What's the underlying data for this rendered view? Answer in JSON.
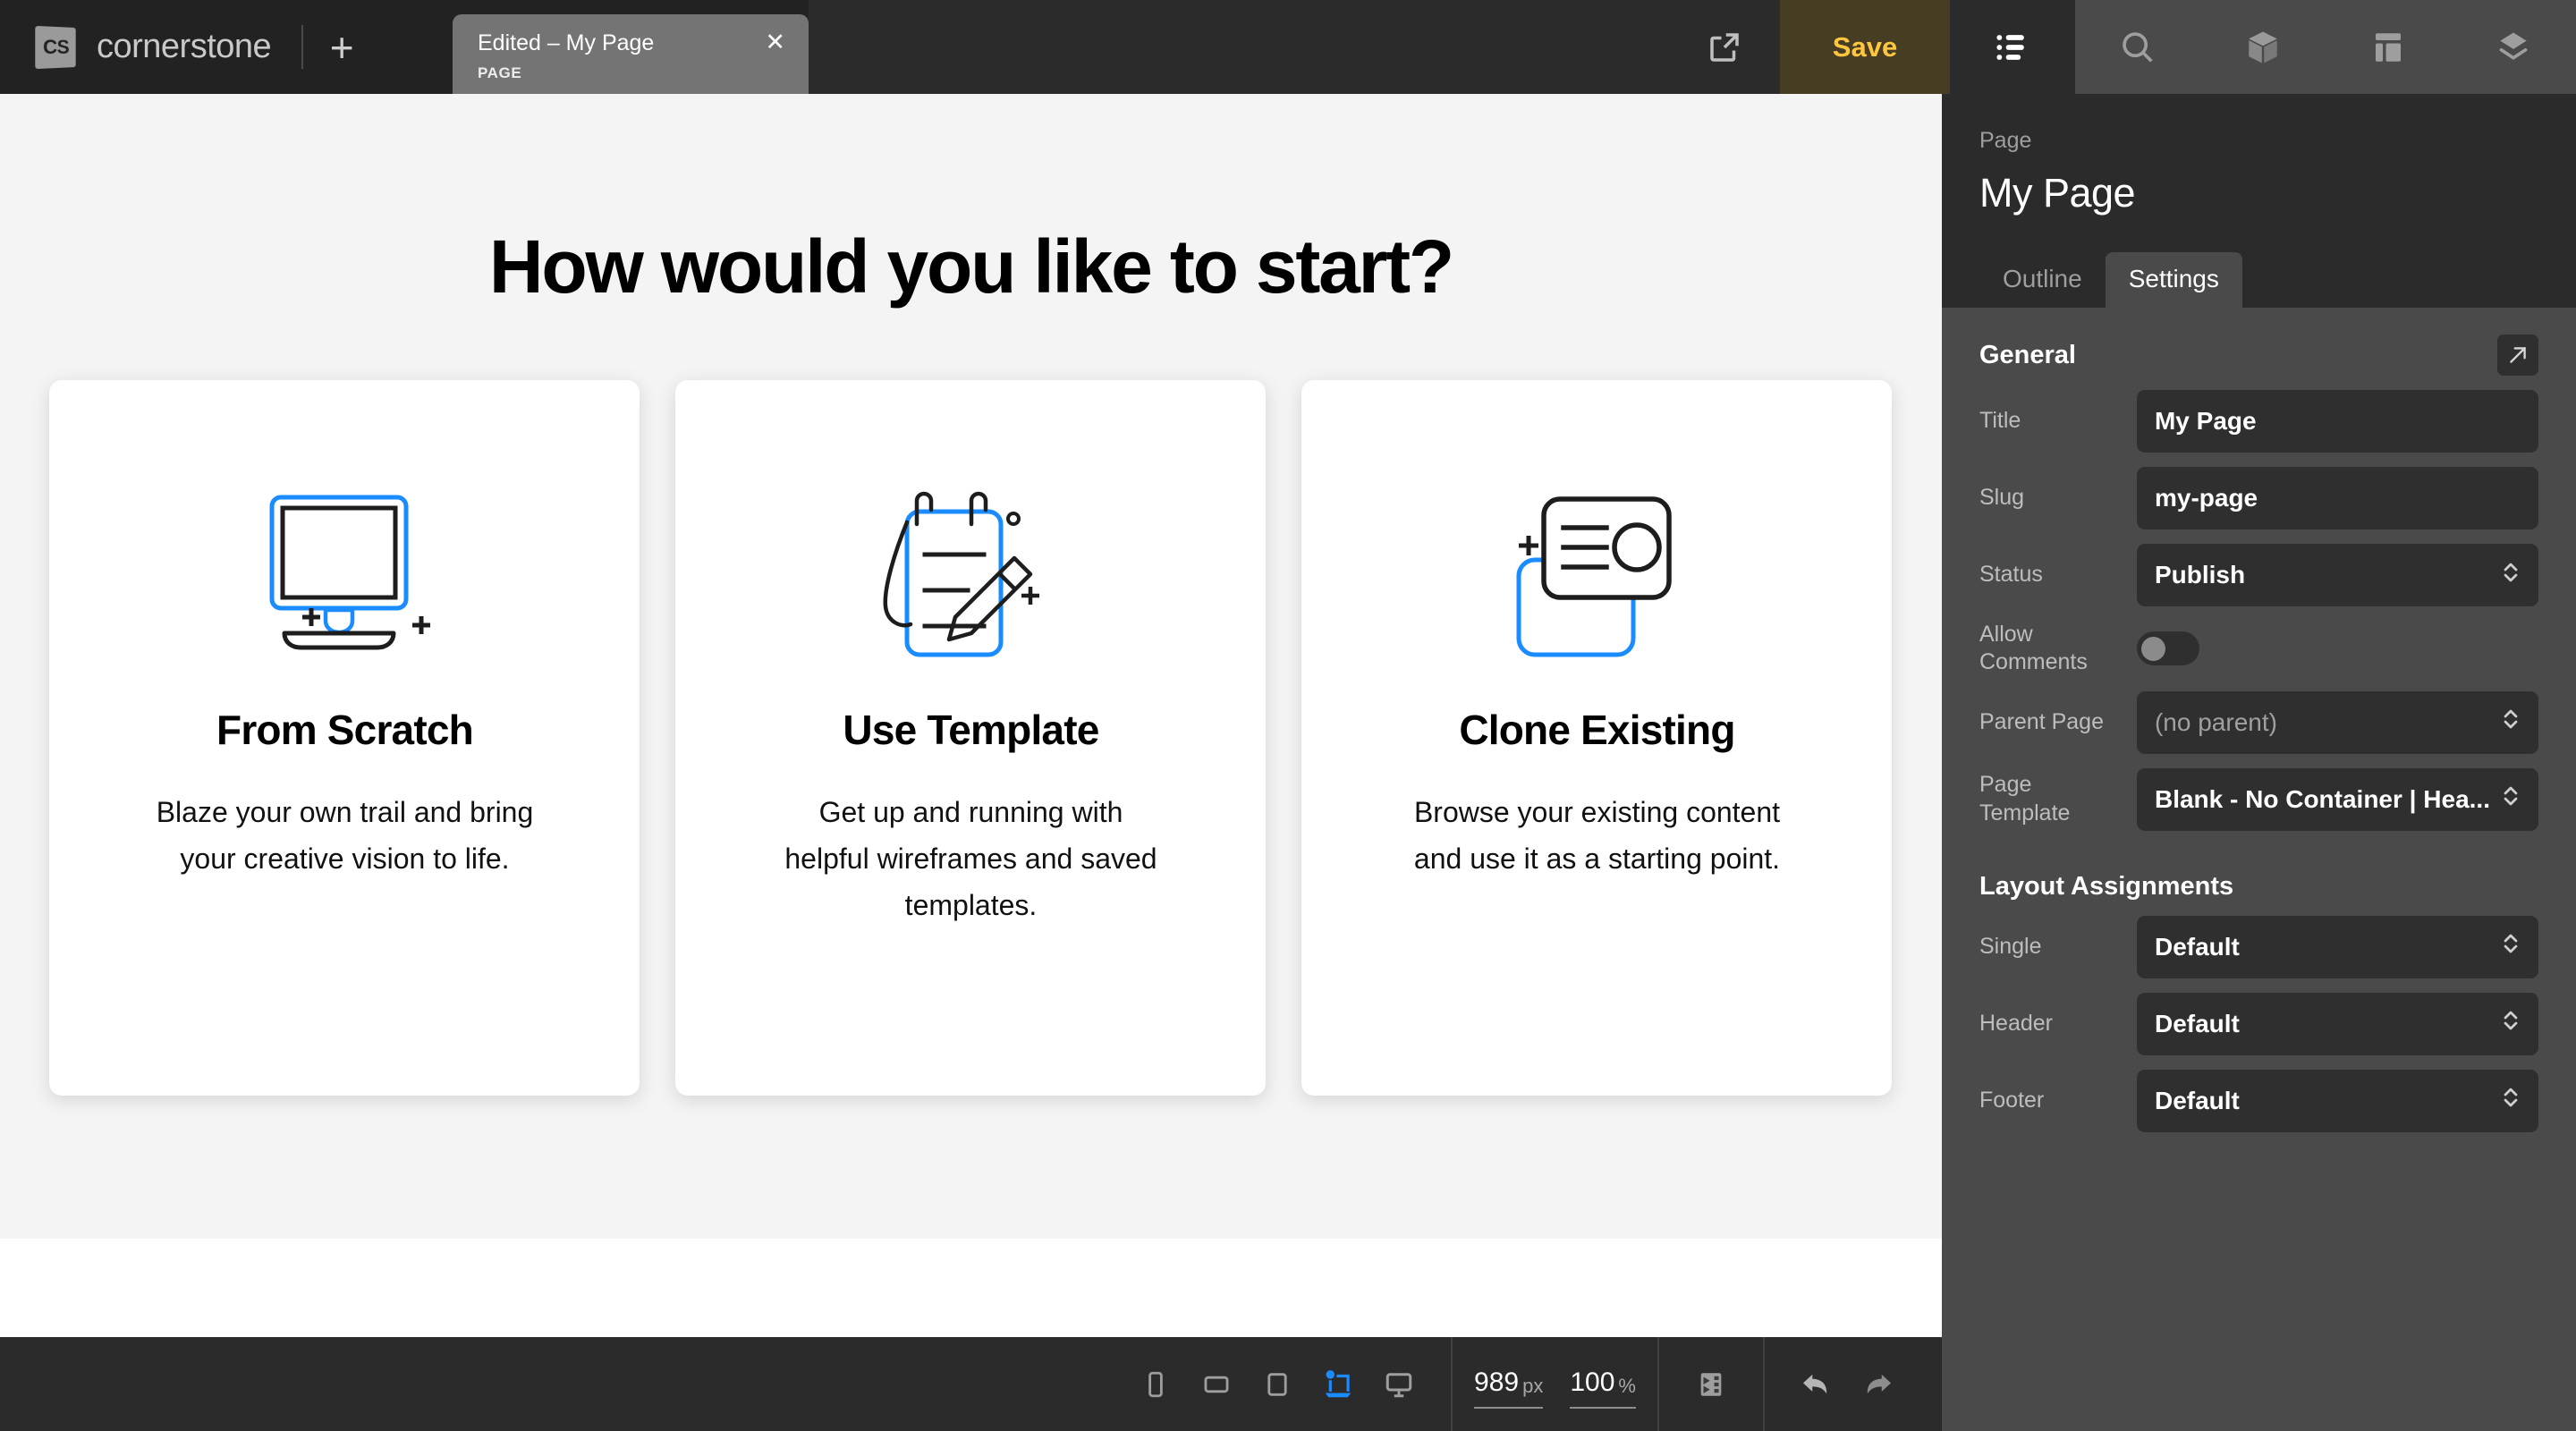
{
  "topbar": {
    "logo_text": "CS",
    "brand_name": "cornerstone",
    "new_tab_label": "+",
    "tab": {
      "title": "Edited – My Page",
      "subtitle": "PAGE",
      "close_label": "✕"
    },
    "export_icon": "external-link-icon",
    "save_label": "Save",
    "rail": [
      {
        "icon": "outline-list-icon",
        "active": true
      },
      {
        "icon": "search-icon",
        "active": false
      },
      {
        "icon": "element-box-icon",
        "active": false
      },
      {
        "icon": "layout-grid-icon",
        "active": false
      },
      {
        "icon": "layers-icon",
        "active": false
      }
    ]
  },
  "canvas": {
    "heading": "How would you like to start?",
    "cards": [
      {
        "icon": "monitor-plus-icon",
        "title": "From Scratch",
        "description": "Blaze your own trail and bring your creative vision to life."
      },
      {
        "icon": "notepad-pencil-icon",
        "title": "Use Template",
        "description": "Get up and running with helpful wireframes and saved templates."
      },
      {
        "icon": "clone-cards-icon",
        "title": "Clone Existing",
        "description": "Browse your existing content and use it as a starting point."
      }
    ]
  },
  "bottombar": {
    "devices": [
      {
        "icon": "phone-portrait-icon",
        "active": false
      },
      {
        "icon": "tablet-landscape-icon",
        "active": false
      },
      {
        "icon": "tablet-portrait-icon",
        "active": false
      },
      {
        "icon": "laptop-icon",
        "active": true
      },
      {
        "icon": "desktop-icon",
        "active": false
      }
    ],
    "width_value": "989",
    "width_unit": "px",
    "zoom_value": "100",
    "zoom_unit": "%",
    "code_icon": "code-panel-icon",
    "undo_icon": "undo-arrow-icon",
    "redo_icon": "redo-arrow-icon",
    "accent_color": "#1a8cff"
  },
  "panel": {
    "breadcrumb": "Page",
    "title": "My Page",
    "tabs": [
      {
        "label": "Outline",
        "active": false
      },
      {
        "label": "Settings",
        "active": true
      }
    ],
    "general": {
      "section_title": "General",
      "expand_icon": "open-external-icon",
      "fields": [
        {
          "label": "Title",
          "value": "My Page",
          "type": "input"
        },
        {
          "label": "Slug",
          "value": "my-page",
          "type": "input"
        },
        {
          "label": "Status",
          "value": "Publish",
          "type": "select"
        },
        {
          "label": "Allow Comments",
          "value": "off",
          "type": "toggle"
        },
        {
          "label": "Parent Page",
          "value": "(no parent)",
          "type": "select-muted"
        },
        {
          "label": "Page Template",
          "value": "Blank - No Container | Hea...",
          "type": "select"
        }
      ]
    },
    "layout": {
      "section_title": "Layout Assignments",
      "fields": [
        {
          "label": "Single",
          "value": "Default",
          "type": "select"
        },
        {
          "label": "Header",
          "value": "Default",
          "type": "select"
        },
        {
          "label": "Footer",
          "value": "Default",
          "type": "select"
        }
      ]
    }
  }
}
